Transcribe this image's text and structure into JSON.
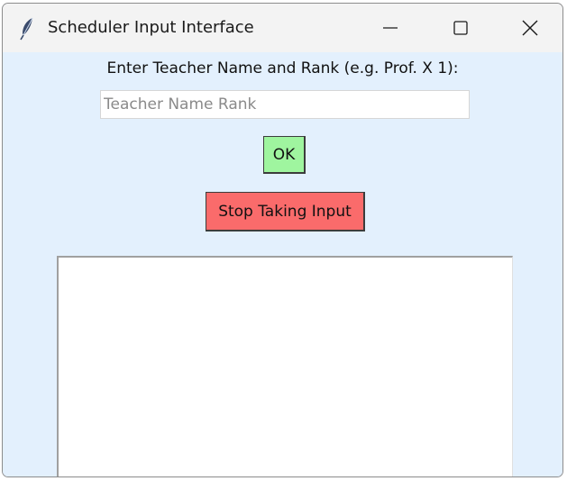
{
  "window": {
    "title": "Scheduler Input Interface",
    "icon": "feather-icon"
  },
  "controls": {
    "minimize_icon": "minimize-icon",
    "maximize_icon": "maximize-icon",
    "close_icon": "close-icon"
  },
  "form": {
    "prompt": "Enter Teacher Name and Rank (e.g. Prof. X 1):",
    "input_value": "",
    "input_placeholder": "Teacher Name Rank",
    "ok_label": "OK",
    "stop_label": "Stop Taking Input",
    "output_text": ""
  },
  "colors": {
    "background": "#e3f0fd",
    "ok_button": "#9ff59f",
    "stop_button": "#fa6b6b"
  }
}
